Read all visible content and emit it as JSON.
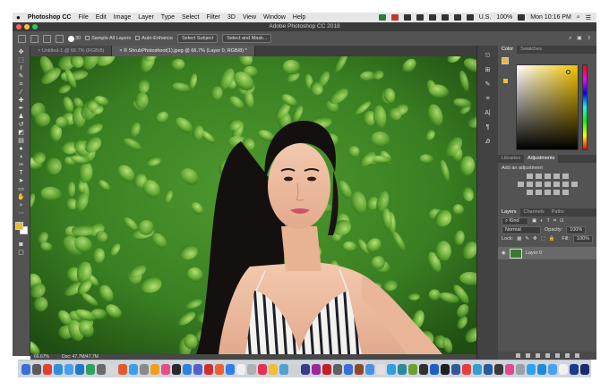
{
  "menubar": {
    "app_name": "Photoshop CC",
    "items": [
      "File",
      "Edit",
      "Image",
      "Layer",
      "Type",
      "Select",
      "Filter",
      "3D",
      "View",
      "Window",
      "Help"
    ],
    "locale": "U.S.",
    "battery": "100%",
    "clock": "Mon 10:16 PM"
  },
  "window": {
    "title": "Adobe Photoshop CC 2018"
  },
  "options_bar": {
    "brush_size": "30",
    "sample_all_layers": "Sample All Layers",
    "auto_enhance": "Auto-Enhance",
    "select_subject": "Select Subject",
    "select_and_mask": "Select and Mask..."
  },
  "doc_tabs": [
    {
      "label": "Untitled-1 @ 66.7% (RGB/8)",
      "active": false
    },
    {
      "label": "© ShrubPhotoshoot(1).jpeg @ 66.7% (Layer 0, RGB/8) *",
      "active": true
    }
  ],
  "status": {
    "zoom": "66.67%",
    "doc_size": "Doc: 47.7M/47.7M"
  },
  "color_panel": {
    "tabs": [
      "Color",
      "Swatches"
    ],
    "foreground": "#e8b930",
    "background": "#ffffff"
  },
  "adjustments_panel": {
    "tabs": [
      "Libraries",
      "Adjustments"
    ],
    "heading": "Add an adjustment"
  },
  "layers_panel": {
    "tabs": [
      "Layers",
      "Channels",
      "Paths"
    ],
    "filter_kind": "Kind",
    "blend_mode": "Normal",
    "opacity_label": "Opacity:",
    "opacity": "100%",
    "lock_label": "Lock:",
    "fill_label": "Fill:",
    "fill": "100%",
    "layers": [
      {
        "name": "Layer 0",
        "visible": true
      }
    ]
  },
  "dock": {
    "app_colors": [
      "#3a6fd8",
      "#5a5a5a",
      "#e0402e",
      "#2f8fd8",
      "#4aa0e8",
      "#1f78c8",
      "#30a060",
      "#6a6a6a",
      "#d8d8d8",
      "#e05a30",
      "#3aa0f0",
      "#8a8a8a",
      "#f0a020",
      "#e84a8a",
      "#2a2a2a",
      "#3080e0",
      "#5060d0",
      "#cc3030",
      "#f06030",
      "#3080e8",
      "#f0f0f0",
      "#b0b0b0",
      "#e83050",
      "#f0c030",
      "#50a0d0",
      "#d0d0d0",
      "#3a3a8a",
      "#9a2a9a",
      "#c02020",
      "#606060",
      "#3a6fd8",
      "#8a4a2a",
      "#4a90e0",
      "#e0e0e0",
      "#30a0e0",
      "#2a8aa0",
      "#6aa030",
      "#303030",
      "#2060c0",
      "#202020",
      "#305a9a",
      "#e04040",
      "#30a0d0",
      "#2a5a9a",
      "#3a3a3a",
      "#e04a8a",
      "#9aa0a8",
      "#30a0f0",
      "#1e8ad8",
      "#4aa0f0",
      "#f0f0f0",
      "#1a3a8a",
      "#1a2a6a",
      "#1a4ab0",
      "#1a2a6a",
      "#2a1a5a",
      "#c05a10",
      "#2a5ab0",
      "#1a2a5a",
      "#f0f0f0",
      "#e03030",
      "#f0f0f0",
      "#f0f0f0",
      "#f0f0f0",
      "#f0f0f0",
      "#f0f0f0",
      "#f0f0f0",
      "#9aa0a8"
    ]
  }
}
